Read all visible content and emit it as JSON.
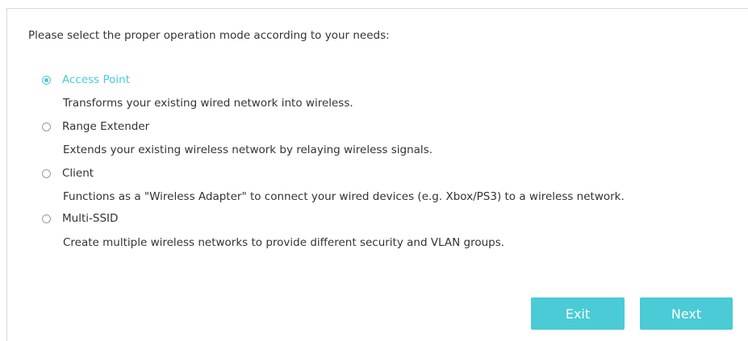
{
  "intro_text": "Please select the proper operation mode according to your needs:",
  "modes": [
    {
      "label": "Access Point",
      "description": "Transforms your existing wired network into wireless.",
      "selected": true
    },
    {
      "label": "Range Extender",
      "description": "Extends your existing wireless network by relaying wireless signals.",
      "selected": false
    },
    {
      "label": "Client",
      "description": "Functions as a \"Wireless Adapter\" to connect your wired devices (e.g. Xbox/PS3) to a wireless network.",
      "selected": false
    },
    {
      "label": "Multi-SSID",
      "description": "Create multiple wireless networks to provide different security and VLAN groups.",
      "selected": false
    }
  ],
  "buttons": {
    "exit_label": "Exit",
    "next_label": "Next"
  },
  "colors": {
    "accent": "#4acbd6",
    "text": "#333333",
    "border": "#d9d9d9"
  }
}
